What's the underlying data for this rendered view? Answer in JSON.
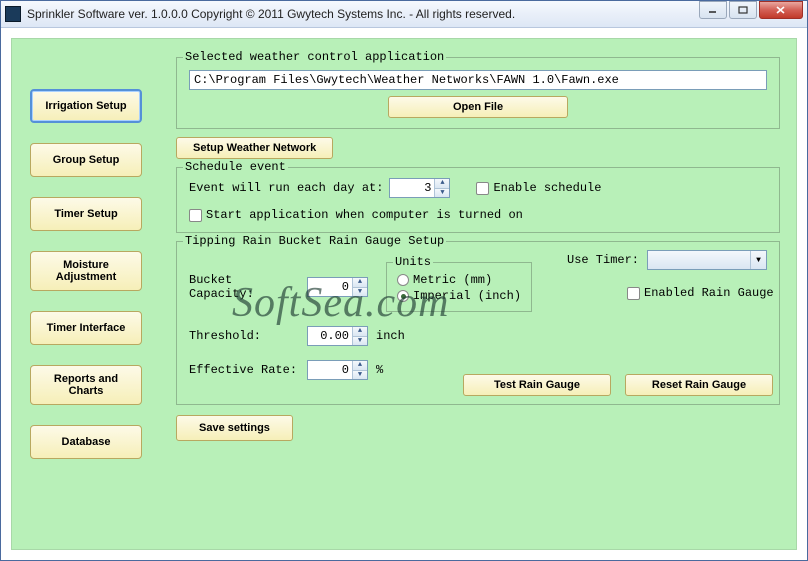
{
  "window": {
    "title": "Sprinkler Software ver. 1.0.0.0     Copyright © 2011 Gwytech Systems Inc. - All rights reserved."
  },
  "sidebar": {
    "items": [
      {
        "label": "Irrigation Setup"
      },
      {
        "label": "Group Setup"
      },
      {
        "label": "Timer Setup"
      },
      {
        "label": "Moisture Adjustment"
      },
      {
        "label": "Timer Interface"
      },
      {
        "label": "Reports and Charts"
      },
      {
        "label": "Database"
      }
    ]
  },
  "app_select": {
    "legend": "Selected weather control application",
    "path": "C:\\Program Files\\Gwytech\\Weather Networks\\FAWN 1.0\\Fawn.exe",
    "open_label": "Open File"
  },
  "setup_network_label": "Setup Weather Network",
  "schedule": {
    "legend": "Schedule event",
    "event_label": "Event will run each day at:",
    "event_value": "3",
    "enable_label": "Enable schedule",
    "startup_label": "Start application when computer is turned on"
  },
  "rain": {
    "legend": "Tipping Rain Bucket Rain Gauge Setup",
    "bucket_label": "Bucket Capacity:",
    "bucket_value": "0",
    "threshold_label": "Threshold:",
    "threshold_value": "0.00",
    "threshold_unit": "inch",
    "effrate_label": "Effective Rate:",
    "effrate_value": "0",
    "effrate_unit": "%",
    "units_legend": "Units",
    "unit_metric": "Metric (mm)",
    "unit_imperial": "Imperial (inch)",
    "use_timer_label": "Use Timer:",
    "use_timer_value": "",
    "enabled_label": "Enabled Rain Gauge",
    "test_label": "Test Rain Gauge",
    "reset_label": "Reset Rain Gauge"
  },
  "save_label": "Save settings",
  "watermark": "SoftSea.com"
}
